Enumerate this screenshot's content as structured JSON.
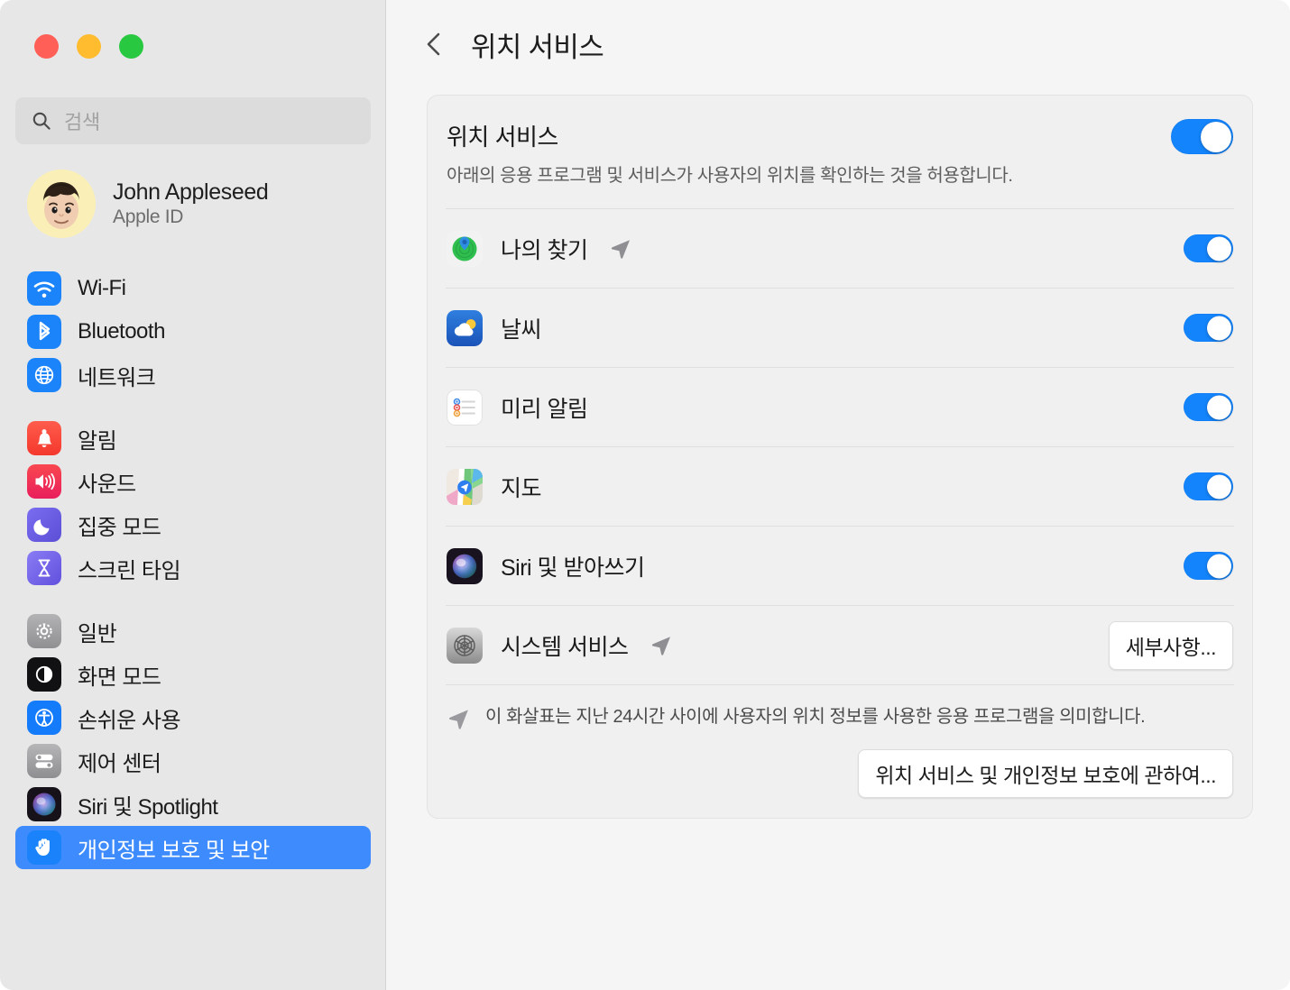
{
  "window": {
    "traffic_lights": [
      {
        "name": "close",
        "color": "#ff5f57"
      },
      {
        "name": "minimize",
        "color": "#febc2e"
      },
      {
        "name": "maximize",
        "color": "#28c840"
      }
    ]
  },
  "sidebar": {
    "search": {
      "placeholder": "검색",
      "value": "",
      "icon": "search-icon"
    },
    "account": {
      "name": "John Appleseed",
      "subtitle": "Apple ID",
      "avatar": "memoji-avatar"
    },
    "groups": [
      {
        "items": [
          {
            "label": "Wi-Fi",
            "icon": "wifi-icon",
            "selected": false
          },
          {
            "label": "Bluetooth",
            "icon": "bluetooth-icon",
            "selected": false
          },
          {
            "label": "네트워크",
            "icon": "network-icon",
            "selected": false
          }
        ]
      },
      {
        "items": [
          {
            "label": "알림",
            "icon": "notifications-icon",
            "selected": false
          },
          {
            "label": "사운드",
            "icon": "sound-icon",
            "selected": false
          },
          {
            "label": "집중 모드",
            "icon": "focus-icon",
            "selected": false
          },
          {
            "label": "스크린 타임",
            "icon": "screentime-icon",
            "selected": false
          }
        ]
      },
      {
        "items": [
          {
            "label": "일반",
            "icon": "general-icon",
            "selected": false
          },
          {
            "label": "화면 모드",
            "icon": "appearance-icon",
            "selected": false
          },
          {
            "label": "손쉬운 사용",
            "icon": "accessibility-icon",
            "selected": false
          },
          {
            "label": "제어 센터",
            "icon": "control-center-icon",
            "selected": false
          },
          {
            "label": "Siri 및 Spotlight",
            "icon": "siri-icon",
            "selected": false
          },
          {
            "label": "개인정보 보호 및 보안",
            "icon": "privacy-hand-icon",
            "selected": true
          }
        ]
      }
    ]
  },
  "main": {
    "back_button_icon": "chevron-left-icon",
    "title": "위치 서비스",
    "header": {
      "title": "위치 서비스",
      "subtitle": "아래의 응용 프로그램 및 서비스가 사용자의 위치를 확인하는 것을 허용합니다.",
      "toggle_on": true
    },
    "apps": [
      {
        "label": "나의 찾기",
        "icon": "findmy-icon",
        "toggle_on": true,
        "recent_arrow": true,
        "control": "toggle"
      },
      {
        "label": "날씨",
        "icon": "weather-icon",
        "toggle_on": true,
        "recent_arrow": false,
        "control": "toggle"
      },
      {
        "label": "미리 알림",
        "icon": "reminders-icon",
        "toggle_on": true,
        "recent_arrow": false,
        "control": "toggle"
      },
      {
        "label": "지도",
        "icon": "maps-icon",
        "toggle_on": true,
        "recent_arrow": false,
        "control": "toggle"
      },
      {
        "label": "Siri 및 받아쓰기",
        "icon": "siri-icon",
        "toggle_on": true,
        "recent_arrow": false,
        "control": "toggle"
      },
      {
        "label": "시스템 서비스",
        "icon": "system-services-icon",
        "toggle_on": false,
        "recent_arrow": true,
        "control": "button",
        "button_label": "세부사항..."
      }
    ],
    "footnote": {
      "icon": "location-arrow-icon",
      "text": "이 화살표는 지난 24시간 사이에 사용자의 위치 정보를 사용한 응용 프로그램을 의미합니다."
    },
    "privacy_button_label": "위치 서비스 및 개인정보 보호에 관하여..."
  },
  "colors": {
    "accent_blue": "#1384fb",
    "selection_blue": "#3d8bfd",
    "sidebar_bg": "#e7e7e7",
    "content_bg": "#f5f5f5",
    "card_bg": "#f0f0f0",
    "arrow_gray": "#8e8e93"
  }
}
